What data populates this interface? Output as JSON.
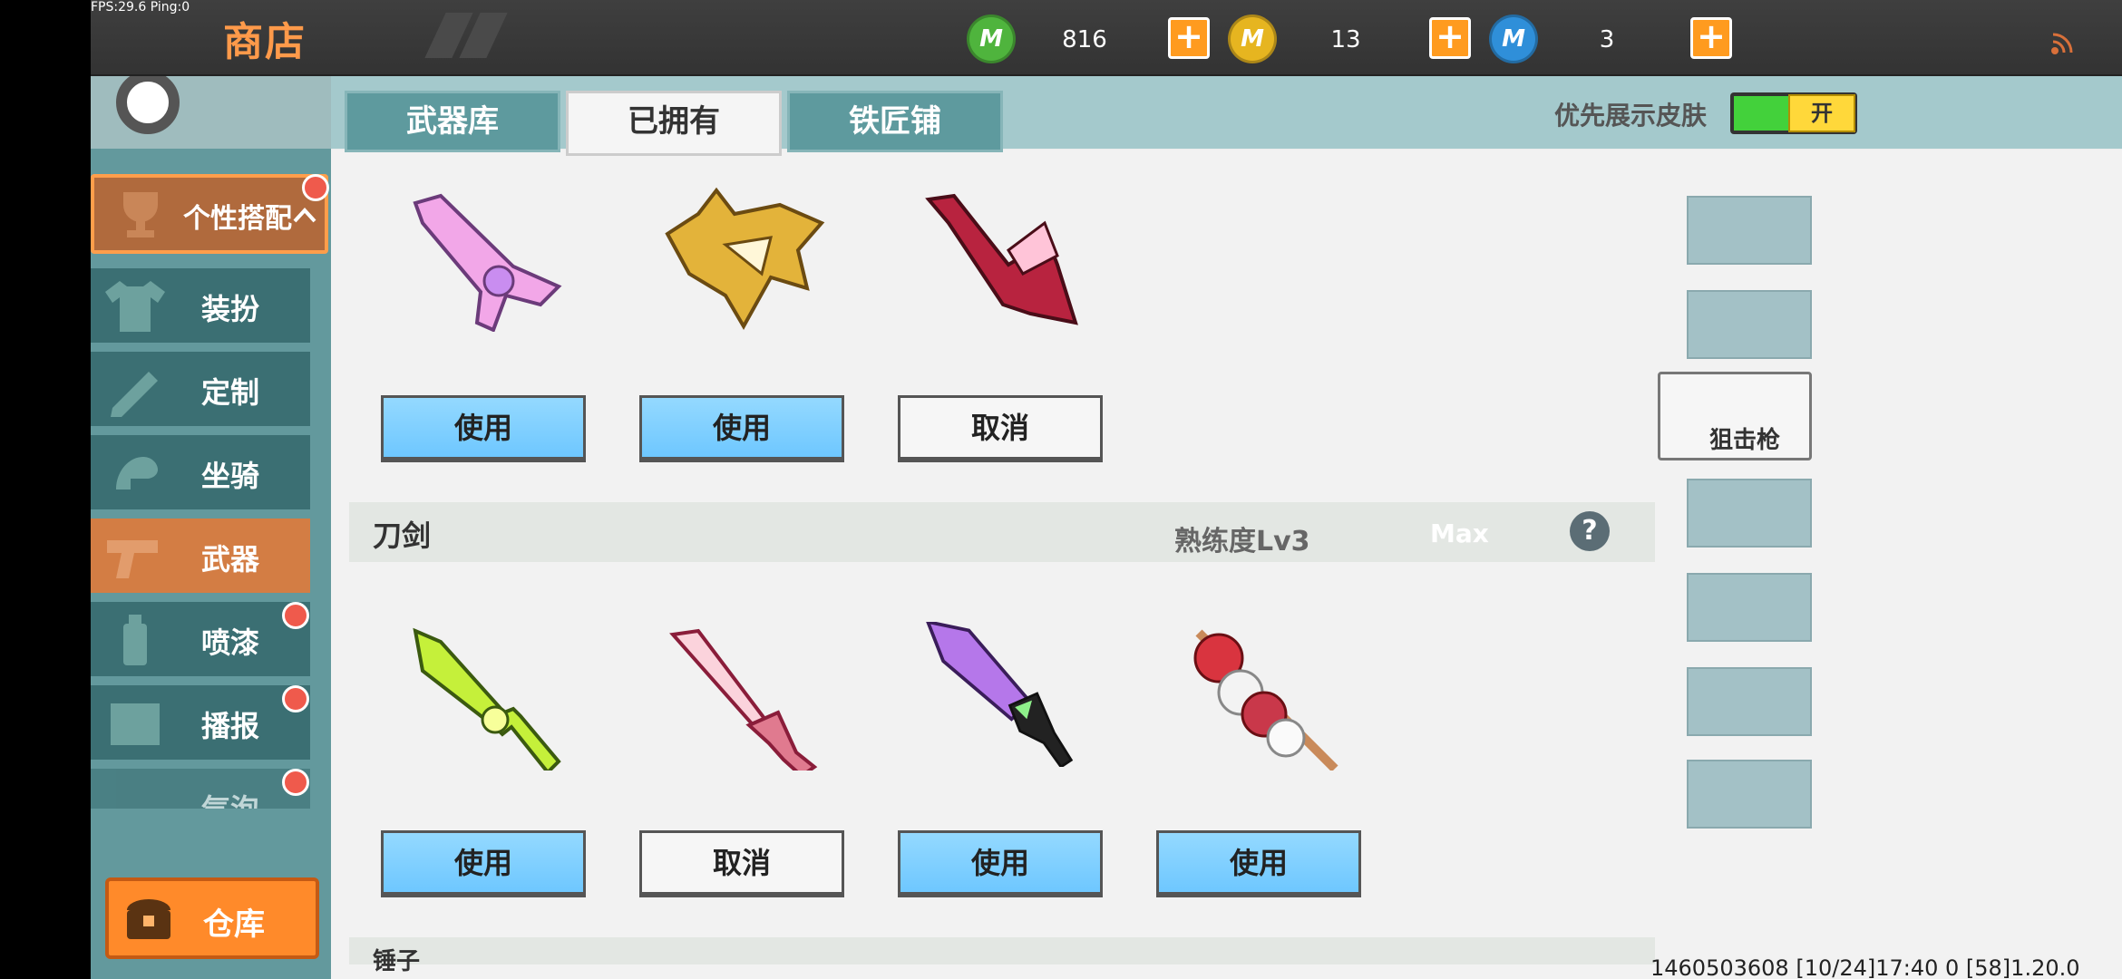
{
  "debug": {
    "fps_ping": "FPS:29.6  Ping:0"
  },
  "header": {
    "title": "商店",
    "currencies": [
      {
        "value": "816",
        "icon": "green-m-coin-icon",
        "color": "#4fb43d"
      },
      {
        "value": "13",
        "icon": "gold-m-coin-icon",
        "color": "#e6b520"
      },
      {
        "value": "3",
        "icon": "blue-m-coin-icon",
        "color": "#2f8fd9"
      }
    ],
    "plus": "+",
    "coin_letter": "M"
  },
  "sidebar": {
    "group_label": "个性搭配",
    "items": [
      {
        "label": "装扮"
      },
      {
        "label": "定制"
      },
      {
        "label": "坐骑"
      },
      {
        "label": "武器"
      },
      {
        "label": "喷漆"
      },
      {
        "label": "播报"
      },
      {
        "label": "气泡"
      }
    ],
    "active": "武器",
    "warehouse_label": "仓库"
  },
  "tabs": [
    {
      "label": "武器库"
    },
    {
      "label": "已拥有"
    },
    {
      "label": "铁匠铺"
    }
  ],
  "active_tab": "已拥有",
  "skin_toggle": {
    "label": "优先展示皮肤",
    "state": "开"
  },
  "guns": {
    "buttons": [
      {
        "label": "使用",
        "type": "use"
      },
      {
        "label": "使用",
        "type": "use"
      },
      {
        "label": "取消",
        "type": "cancel"
      }
    ]
  },
  "blades": {
    "section_name": "刀剑",
    "proficiency": "熟练度Lv3",
    "max": "Max",
    "help": "?",
    "buttons": [
      {
        "label": "使用",
        "type": "use"
      },
      {
        "label": "取消",
        "type": "cancel"
      },
      {
        "label": "使用",
        "type": "use"
      },
      {
        "label": "使用",
        "type": "use"
      }
    ]
  },
  "next_section": {
    "name": "锤子"
  },
  "categories": {
    "selected_label": "狙击枪"
  },
  "footer": {
    "info": "1460503608  [10/24]17:40 0  [58]1.20.0"
  }
}
